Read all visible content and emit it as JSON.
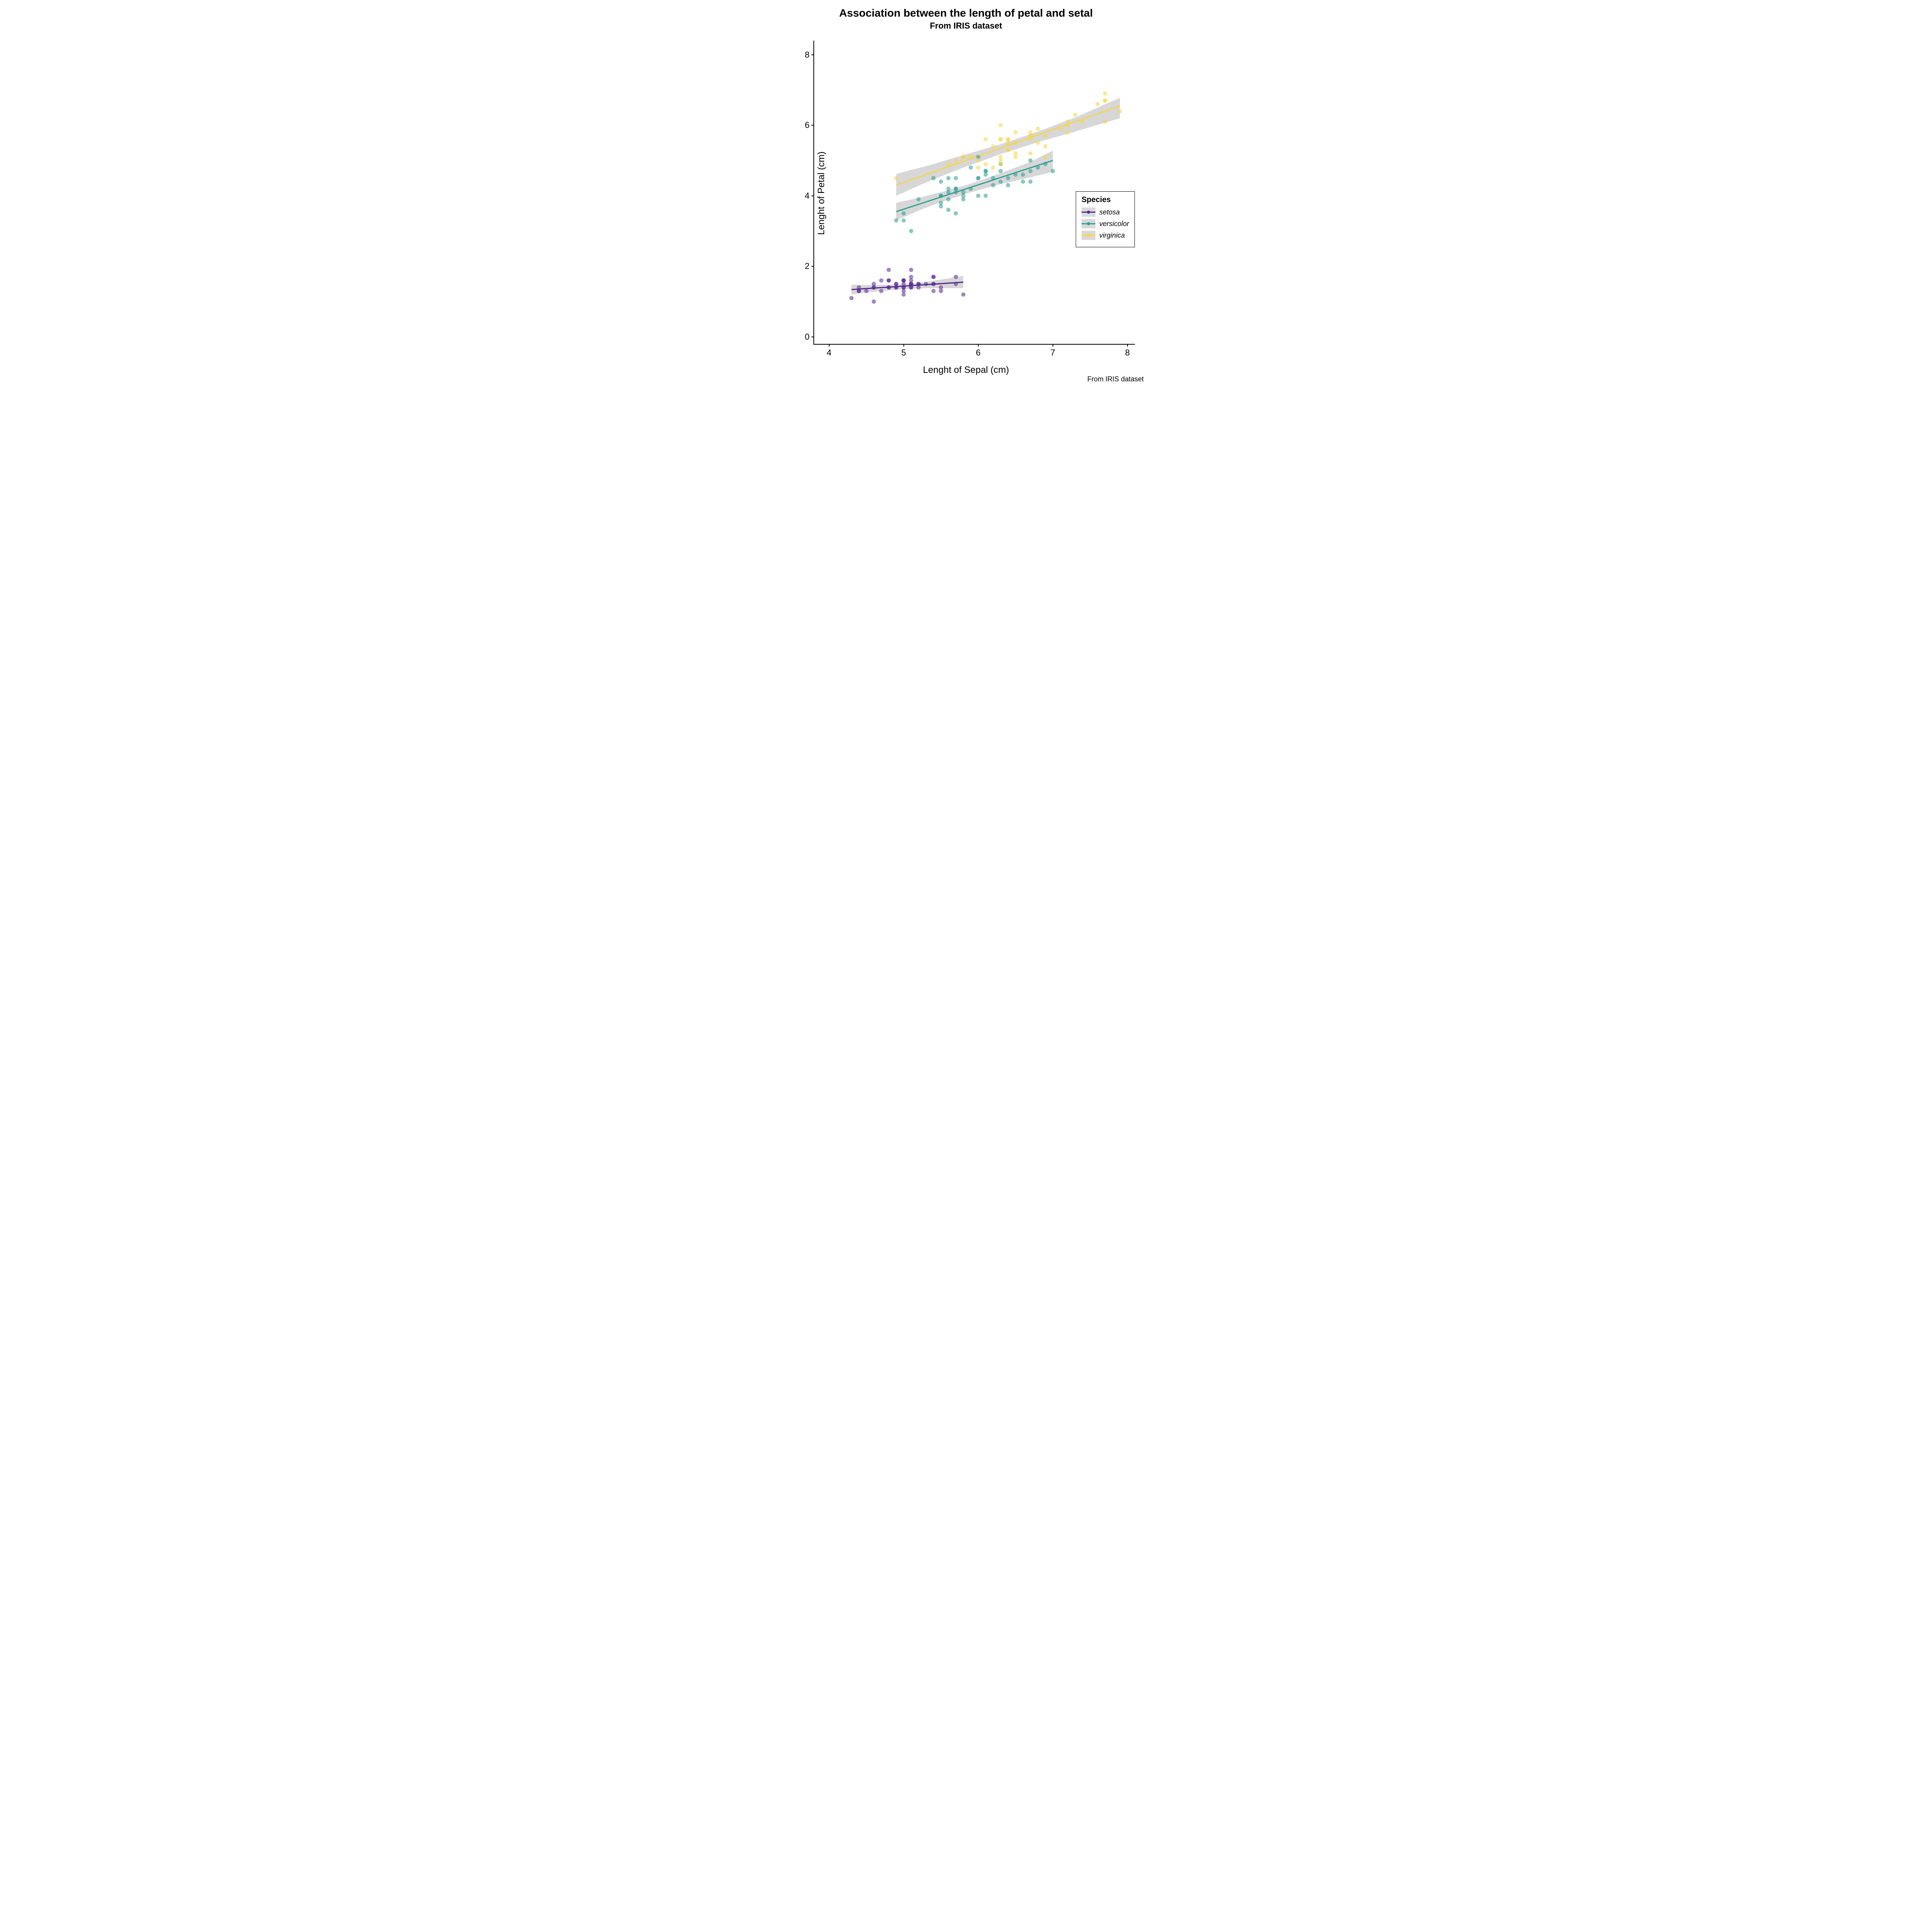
{
  "chart_data": {
    "type": "scatter",
    "title": "Association between the length of petal and setal",
    "subtitle": "From IRIS dataset",
    "caption": "From IRIS dataset",
    "xlabel": "Lenght of Sepal (cm)",
    "ylabel": "Lenght of Petal (cm)",
    "xlim": [
      3.8,
      8.1
    ],
    "ylim": [
      -0.2,
      8.4
    ],
    "x_ticks": [
      4,
      5,
      6,
      7,
      8
    ],
    "y_ticks": [
      0,
      2,
      4,
      6,
      8
    ],
    "legend_title": "Species",
    "series": [
      {
        "name": "setosa",
        "color": "#54278f",
        "points": [
          [
            5.1,
            1.4
          ],
          [
            4.9,
            1.4
          ],
          [
            4.7,
            1.3
          ],
          [
            4.6,
            1.5
          ],
          [
            5.0,
            1.4
          ],
          [
            5.4,
            1.7
          ],
          [
            4.6,
            1.4
          ],
          [
            5.0,
            1.5
          ],
          [
            4.4,
            1.4
          ],
          [
            4.9,
            1.5
          ],
          [
            5.4,
            1.5
          ],
          [
            4.8,
            1.6
          ],
          [
            4.8,
            1.4
          ],
          [
            4.3,
            1.1
          ],
          [
            5.8,
            1.2
          ],
          [
            5.7,
            1.5
          ],
          [
            5.4,
            1.3
          ],
          [
            5.1,
            1.4
          ],
          [
            5.7,
            1.7
          ],
          [
            5.1,
            1.5
          ],
          [
            5.4,
            1.7
          ],
          [
            5.1,
            1.5
          ],
          [
            4.6,
            1.0
          ],
          [
            5.1,
            1.7
          ],
          [
            4.8,
            1.9
          ],
          [
            5.0,
            1.6
          ],
          [
            5.0,
            1.6
          ],
          [
            5.2,
            1.5
          ],
          [
            5.2,
            1.4
          ],
          [
            4.7,
            1.6
          ],
          [
            4.8,
            1.6
          ],
          [
            5.4,
            1.5
          ],
          [
            5.2,
            1.5
          ],
          [
            5.5,
            1.4
          ],
          [
            4.9,
            1.5
          ],
          [
            5.0,
            1.2
          ],
          [
            5.5,
            1.3
          ],
          [
            4.9,
            1.4
          ],
          [
            4.4,
            1.3
          ],
          [
            5.1,
            1.5
          ],
          [
            5.0,
            1.3
          ],
          [
            4.5,
            1.3
          ],
          [
            4.4,
            1.3
          ],
          [
            5.0,
            1.6
          ],
          [
            5.1,
            1.9
          ],
          [
            4.8,
            1.4
          ],
          [
            5.1,
            1.6
          ],
          [
            4.6,
            1.4
          ],
          [
            5.3,
            1.5
          ],
          [
            5.0,
            1.4
          ]
        ],
        "regression": {
          "x0": 4.3,
          "y0": 1.34,
          "x1": 5.8,
          "y1": 1.55
        },
        "ribbon": [
          [
            4.3,
            1.2,
            1.48
          ],
          [
            4.5,
            1.26,
            1.47
          ],
          [
            4.8,
            1.32,
            1.48
          ],
          [
            5.05,
            1.36,
            1.5
          ],
          [
            5.3,
            1.38,
            1.56
          ],
          [
            5.55,
            1.38,
            1.64
          ],
          [
            5.8,
            1.38,
            1.73
          ]
        ]
      },
      {
        "name": "versicolor",
        "color": "#2a9d8f",
        "points": [
          [
            7.0,
            4.7
          ],
          [
            6.4,
            4.5
          ],
          [
            6.9,
            4.9
          ],
          [
            5.5,
            4.0
          ],
          [
            6.5,
            4.6
          ],
          [
            5.7,
            4.5
          ],
          [
            6.3,
            4.7
          ],
          [
            4.9,
            3.3
          ],
          [
            6.6,
            4.6
          ],
          [
            5.2,
            3.9
          ],
          [
            5.0,
            3.5
          ],
          [
            5.9,
            4.2
          ],
          [
            6.0,
            4.0
          ],
          [
            6.1,
            4.7
          ],
          [
            5.6,
            3.6
          ],
          [
            6.7,
            4.4
          ],
          [
            5.6,
            4.5
          ],
          [
            5.8,
            4.1
          ],
          [
            6.2,
            4.5
          ],
          [
            5.6,
            3.9
          ],
          [
            5.9,
            4.8
          ],
          [
            6.1,
            4.0
          ],
          [
            6.3,
            4.9
          ],
          [
            6.1,
            4.7
          ],
          [
            6.4,
            4.3
          ],
          [
            6.6,
            4.4
          ],
          [
            6.8,
            4.8
          ],
          [
            6.7,
            5.0
          ],
          [
            6.0,
            4.5
          ],
          [
            5.7,
            3.5
          ],
          [
            5.5,
            3.8
          ],
          [
            5.5,
            3.7
          ],
          [
            5.8,
            3.9
          ],
          [
            6.0,
            5.1
          ],
          [
            5.4,
            4.5
          ],
          [
            6.0,
            4.5
          ],
          [
            6.7,
            4.7
          ],
          [
            6.3,
            4.4
          ],
          [
            5.6,
            4.1
          ],
          [
            5.5,
            4.0
          ],
          [
            5.5,
            4.4
          ],
          [
            6.1,
            4.6
          ],
          [
            5.8,
            4.0
          ],
          [
            5.0,
            3.3
          ],
          [
            5.6,
            4.2
          ],
          [
            5.7,
            4.2
          ],
          [
            5.7,
            4.2
          ],
          [
            6.2,
            4.3
          ],
          [
            5.1,
            3.0
          ],
          [
            5.7,
            4.1
          ]
        ],
        "regression": {
          "x0": 4.9,
          "y0": 3.55,
          "x1": 7.0,
          "y1": 5.0
        },
        "ribbon": [
          [
            4.9,
            3.3,
            3.8
          ],
          [
            5.2,
            3.58,
            3.94
          ],
          [
            5.5,
            3.82,
            4.1
          ],
          [
            5.9,
            4.1,
            4.34
          ],
          [
            6.3,
            4.33,
            4.64
          ],
          [
            6.7,
            4.52,
            4.96
          ],
          [
            7.0,
            4.68,
            5.28
          ]
        ]
      },
      {
        "name": "virginica",
        "color": "#f5d547",
        "points": [
          [
            6.3,
            6.0
          ],
          [
            5.8,
            5.1
          ],
          [
            7.1,
            5.9
          ],
          [
            6.3,
            5.6
          ],
          [
            6.5,
            5.8
          ],
          [
            7.6,
            6.6
          ],
          [
            4.9,
            4.5
          ],
          [
            7.3,
            6.3
          ],
          [
            6.7,
            5.8
          ],
          [
            7.2,
            6.1
          ],
          [
            6.5,
            5.1
          ],
          [
            6.4,
            5.3
          ],
          [
            6.8,
            5.5
          ],
          [
            5.7,
            5.0
          ],
          [
            5.8,
            5.1
          ],
          [
            6.4,
            5.3
          ],
          [
            6.5,
            5.5
          ],
          [
            7.7,
            6.7
          ],
          [
            7.7,
            6.9
          ],
          [
            6.0,
            5.0
          ],
          [
            6.9,
            5.7
          ],
          [
            5.6,
            4.9
          ],
          [
            7.7,
            6.7
          ],
          [
            6.3,
            4.9
          ],
          [
            6.7,
            5.7
          ],
          [
            7.2,
            6.0
          ],
          [
            6.2,
            4.8
          ],
          [
            6.1,
            4.9
          ],
          [
            6.4,
            5.6
          ],
          [
            7.2,
            5.8
          ],
          [
            7.4,
            6.1
          ],
          [
            7.9,
            6.4
          ],
          [
            6.4,
            5.6
          ],
          [
            6.3,
            5.1
          ],
          [
            6.1,
            5.6
          ],
          [
            7.7,
            6.1
          ],
          [
            6.3,
            5.6
          ],
          [
            6.4,
            5.5
          ],
          [
            6.0,
            4.8
          ],
          [
            6.9,
            5.4
          ],
          [
            6.7,
            5.6
          ],
          [
            6.9,
            5.1
          ],
          [
            5.8,
            5.1
          ],
          [
            6.8,
            5.9
          ],
          [
            6.7,
            5.7
          ],
          [
            6.7,
            5.2
          ],
          [
            6.3,
            5.0
          ],
          [
            6.5,
            5.2
          ],
          [
            6.2,
            5.4
          ],
          [
            5.9,
            5.1
          ]
        ],
        "regression": {
          "x0": 4.9,
          "y0": 4.3,
          "x1": 7.9,
          "y1": 6.55
        },
        "ribbon": [
          [
            4.9,
            4.0,
            4.62
          ],
          [
            5.3,
            4.38,
            4.84
          ],
          [
            5.8,
            4.8,
            5.15
          ],
          [
            6.3,
            5.18,
            5.46
          ],
          [
            6.8,
            5.52,
            5.82
          ],
          [
            7.3,
            5.82,
            6.22
          ],
          [
            7.9,
            6.2,
            6.78
          ]
        ]
      }
    ]
  },
  "colors": {
    "setosa": "#54278f",
    "versicolor": "#2a9d8f",
    "virginica": "#f5d547",
    "ribbon": "#c0c0c0"
  }
}
